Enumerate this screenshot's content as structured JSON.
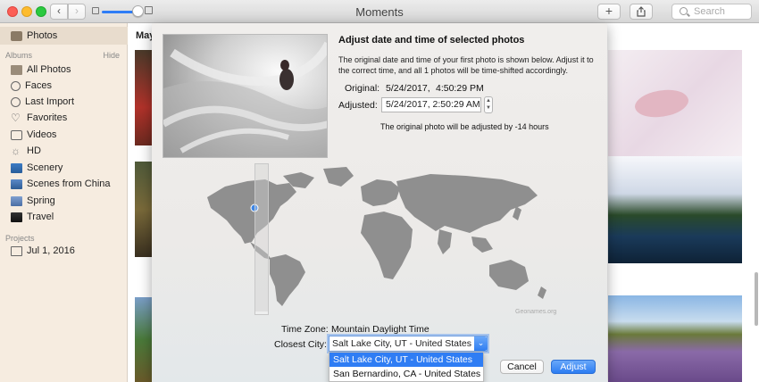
{
  "window": {
    "title": "Moments",
    "search_placeholder": "Search",
    "add_glyph": "+",
    "share_glyph": "⇪",
    "back_glyph": "‹",
    "forward_glyph": "›"
  },
  "sidebar": {
    "top_item": "Photos",
    "albums_heading": "Albums",
    "hide_label": "Hide",
    "albums": [
      {
        "label": "All Photos",
        "icon": "album-icon"
      },
      {
        "label": "Faces",
        "icon": "face-icon"
      },
      {
        "label": "Last Import",
        "icon": "clock-icon"
      },
      {
        "label": "Favorites",
        "icon": "heart-icon"
      },
      {
        "label": "Videos",
        "icon": "video-icon"
      },
      {
        "label": "HD",
        "icon": "hd-icon"
      },
      {
        "label": "Scenery",
        "icon": "album-thumb-icon"
      },
      {
        "label": "Scenes from China",
        "icon": "album-thumb-icon"
      },
      {
        "label": "Spring",
        "icon": "album-thumb-icon"
      },
      {
        "label": "Travel",
        "icon": "album-thumb-icon"
      }
    ],
    "projects_heading": "Projects",
    "projects": [
      {
        "label": "Jul 1, 2016",
        "icon": "project-icon"
      }
    ]
  },
  "main": {
    "section_label": "May"
  },
  "dialog": {
    "title": "Adjust date and time of selected photos",
    "description": "The original date and time of your first photo is shown below. Adjust it to the correct time, and all 1 photos will be time-shifted accordingly.",
    "original_label": "Original:",
    "original_date": "5/24/2017,",
    "original_time": "4:50:29 PM",
    "adjusted_label": "Adjusted:",
    "adjusted_value": "5/24/2017,   2:50:29 AM",
    "offset_note": "The original photo will be adjusted by -14 hours",
    "map_credit": "Geonames.org",
    "time_zone_label": "Time Zone:",
    "time_zone_value": "Mountain Daylight Time",
    "closest_city_label": "Closest City:",
    "closest_city_value": "Salt Lake City, UT - United States",
    "city_options": [
      "Salt Lake City, UT - United States",
      "San Bernardino, CA - United States"
    ],
    "cancel_label": "Cancel",
    "adjust_label": "Adjust"
  }
}
